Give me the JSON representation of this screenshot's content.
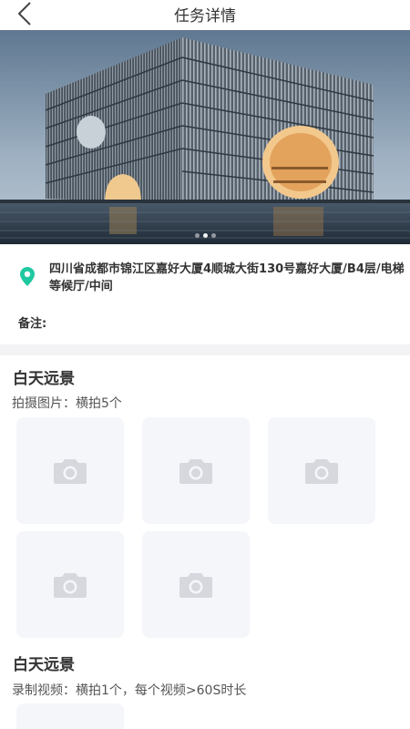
{
  "header": {
    "title": "任务详情",
    "back_icon": "chevron-left-icon"
  },
  "banner": {
    "image": "modern building with vertical fins reflected in water at dusk",
    "slide_count": 3,
    "active_slide": 2
  },
  "location": {
    "icon": "map-pin-icon",
    "icon_color": "#1fc8a0",
    "address": "四川省成都市锦江区嘉好大厦4顺城大街130号嘉好大厦/B4层/电梯等候厅/中间"
  },
  "note": {
    "label": "备注:"
  },
  "sections": [
    {
      "title": "白天远景",
      "desc": "拍摄图片：横拍5个",
      "slot_icon": "camera-icon"
    },
    {
      "title": "白天远景",
      "desc": "录制视频：横拍1个，每个视频>60S时长",
      "slot_icon": "camera-icon"
    }
  ],
  "colors": {
    "slot_bg": "#f5f6fa",
    "camera_icon": "#d6d8de",
    "divider": "#f3f3f5"
  }
}
